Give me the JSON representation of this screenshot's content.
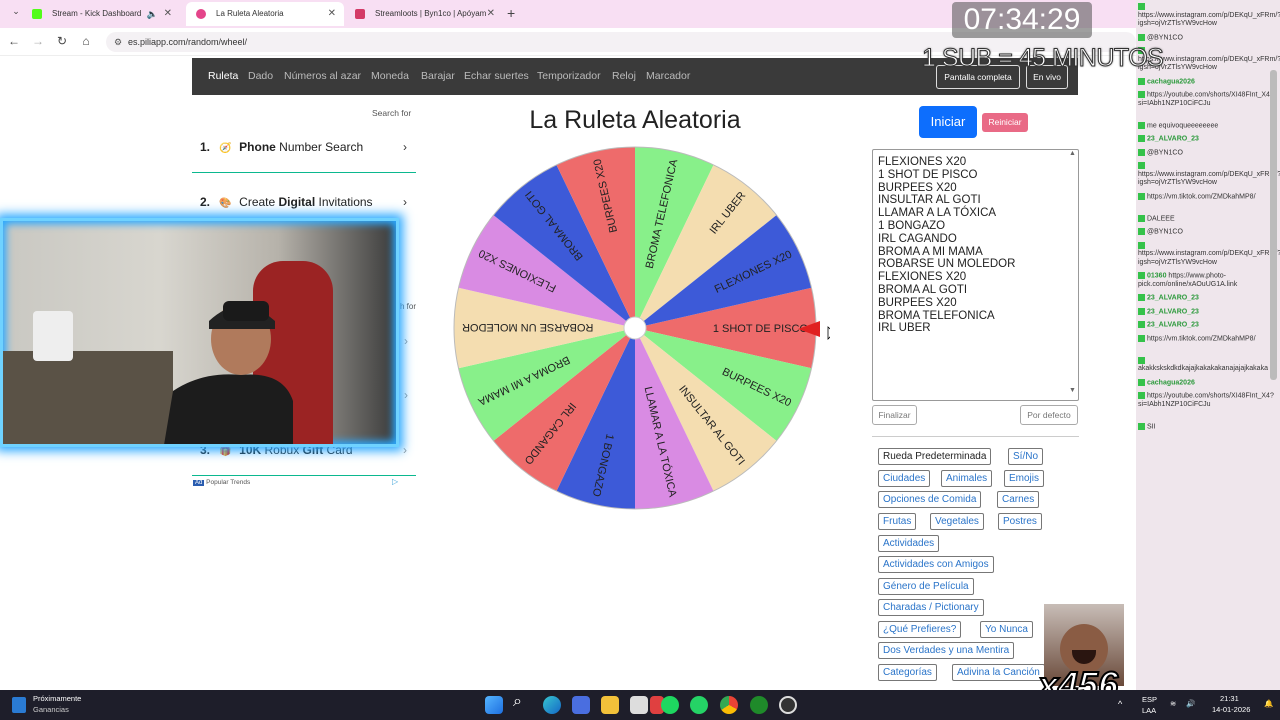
{
  "browser": {
    "tabs": [
      {
        "label": "Stream - Kick Dashboard",
        "active": false,
        "color": "#53fc18"
      },
      {
        "label": "La Ruleta Aleatoria",
        "active": true,
        "color": "#e4458a"
      },
      {
        "label": "Streamloots | Byn1co | Apóyam",
        "active": false,
        "color": "#d33a66"
      }
    ],
    "url": "es.piliapp.com/random/wheel/"
  },
  "site_nav": {
    "links": [
      "Ruleta",
      "Dado",
      "Números al azar",
      "Moneda",
      "Barajar",
      "Echar suertes",
      "Temporizador",
      "Reloj",
      "Marcador"
    ],
    "fullscreen": "Pantalla completa",
    "live": "En vivo"
  },
  "ads": {
    "search_for": "Search for",
    "search_for_2": "h for",
    "items": [
      {
        "num": "1.",
        "pre": "",
        "bold": "Phone",
        "post": " Number Search"
      },
      {
        "num": "2.",
        "pre": "Create ",
        "bold": "Digital",
        "post": " Invitations"
      },
      {
        "num": "3.",
        "pre": "",
        "bold": "10K",
        "post": " Robux ",
        "bold2": "Gift",
        "post2": " Card"
      }
    ],
    "popular": "Popular Trends"
  },
  "main": {
    "title": "La Ruleta Aleatoria",
    "start": "Iniciar",
    "reset": "Reiniciar",
    "finish": "Finalizar",
    "default": "Por defecto"
  },
  "wheel": {
    "rotation_deg": 0,
    "segments": [
      {
        "label": "1 SHOT DE PISCO",
        "color": "#ee6b6b"
      },
      {
        "label": "BURPEES X20",
        "color": "#88f08a"
      },
      {
        "label": "INSULTAR AL GOTI",
        "color": "#f4ddb0"
      },
      {
        "label": "LLAMAR A LA TÓXICA",
        "color": "#d98be3"
      },
      {
        "label": "1 BONGAZO",
        "color": "#3d5ad8"
      },
      {
        "label": "IRL CAGANDO",
        "color": "#ee6b6b"
      },
      {
        "label": "BROMA A MI MAMA",
        "color": "#88f08a"
      },
      {
        "label": "ROBARSE UN MOLEDOR",
        "color": "#f4ddb0"
      },
      {
        "label": "FLEXIONES X20",
        "color": "#d98be3"
      },
      {
        "label": "BROMA AL GOTI",
        "color": "#3d5ad8"
      },
      {
        "label": "BURPEES X20",
        "color": "#ee6b6b"
      },
      {
        "label": "BROMA TELEFONICA",
        "color": "#88f08a"
      },
      {
        "label": "IRL UBER",
        "color": "#f4ddb0"
      },
      {
        "label": "FLEXIONES X20",
        "color": "#3d5ad8"
      }
    ]
  },
  "entries": [
    "FLEXIONES X20",
    "1 SHOT DE PISCO",
    "BURPEES X20",
    "INSULTAR AL GOTI",
    "LLAMAR A LA TÓXICA",
    "1 BONGAZO",
    "IRL CAGANDO",
    "BROMA A MI MAMA",
    "ROBARSE UN MOLEDOR",
    "FLEXIONES X20",
    "BROMA AL GOTI",
    "BURPEES X20",
    "BROMA TELEFONICA",
    "IRL UBER"
  ],
  "presets": [
    [
      "Rueda Predeterminada",
      "Sí/No"
    ],
    [
      "Ciudades",
      "Animales",
      "Emojis"
    ],
    [
      "Opciones de Comida",
      "Carnes"
    ],
    [
      "Frutas",
      "Vegetales",
      "Postres"
    ],
    [
      "Actividades"
    ],
    [
      "Actividades con Amigos"
    ],
    [
      "Género de Película"
    ],
    [
      "Charadas / Pictionary"
    ],
    [
      "¿Qué Prefieres?",
      "Yo Nunca"
    ],
    [
      "Dos Verdades y una Mentira"
    ],
    [
      "Categorías",
      "Adivina la Canción"
    ]
  ],
  "overlay": {
    "clock": "07:34:29",
    "sub_text": "1 SUB = 45 MINUTOS",
    "multiplier": "x456"
  },
  "chat": [
    {
      "u": "",
      "t": "https://www.instagram.com/p/DEKqU_xFRm/?igsh=ojVrZTlsYW9vcHow"
    },
    {
      "u": "",
      "t": "@BYN1CO"
    },
    {
      "u": "",
      "t": "https://www.instagram.com/p/DEKqU_xFRm/?igsh=ojVrZTlsYW9vcHow"
    },
    {
      "u": "cachagua2026",
      "t": ""
    },
    {
      "u": "",
      "t": "https://youtube.com/shorts/XI48FInt_X4?si=IAbh1NZP10CiFCJu"
    },
    {
      "u": "",
      "t": "me equivoqueeeeeeee"
    },
    {
      "u": "23_ALVARO_23",
      "t": ""
    },
    {
      "u": "",
      "t": "@BYN1CO"
    },
    {
      "u": "",
      "t": "https://www.instagram.com/p/DEKqU_xFRm/?igsh=ojVrZTlsYW9vcHow"
    },
    {
      "u": "",
      "t": "https://vm.tiktok.com/ZMDkahMP8/"
    },
    {
      "u": "",
      "t": "DALEEE"
    },
    {
      "u": "",
      "t": "@BYN1CO"
    },
    {
      "u": "",
      "t": "https://www.instagram.com/p/DEKqU_xFRm/?igsh=ojVrZTlsYW9vcHow"
    },
    {
      "u": "01360",
      "t": "https://www.photo-pick.com/online/xAOuUG1A.link"
    },
    {
      "u": "23_ALVARO_23",
      "t": ""
    },
    {
      "u": "23_ALVARO_23",
      "t": ""
    },
    {
      "u": "23_ALVARO_23",
      "t": ""
    },
    {
      "u": "",
      "t": "https://vm.tiktok.com/ZMDkahMP8/"
    },
    {
      "u": "",
      "t": "akakkskskdkdkajajkakakakanajajajkakaka"
    },
    {
      "u": "cachagua2026",
      "t": ""
    },
    {
      "u": "",
      "t": "https://youtube.com/shorts/XI48FInt_X4?si=IAbh1NZP10CiFCJu"
    },
    {
      "u": "",
      "t": "SII"
    }
  ],
  "taskbar": {
    "weather_title": "Próximamente",
    "weather_sub": "Ganancias",
    "lang": "ESP",
    "lang2": "LAA",
    "time": "21:31",
    "date": "14-01-2026"
  }
}
